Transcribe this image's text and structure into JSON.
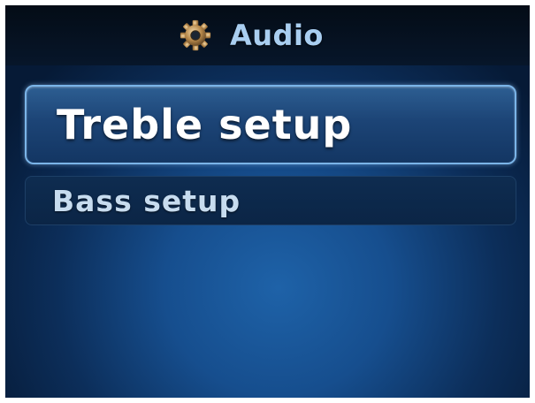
{
  "header": {
    "title": "Audio",
    "icon": "gear-icon"
  },
  "menu": {
    "items": [
      {
        "label": "Treble setup",
        "selected": true
      },
      {
        "label": "Bass setup",
        "selected": false
      }
    ]
  },
  "colors": {
    "background": "#164e8e",
    "title_text": "#a9cef0",
    "selected_border": "#7ab4e8",
    "selected_text": "#ffffff",
    "item_text": "#c7dcef"
  }
}
